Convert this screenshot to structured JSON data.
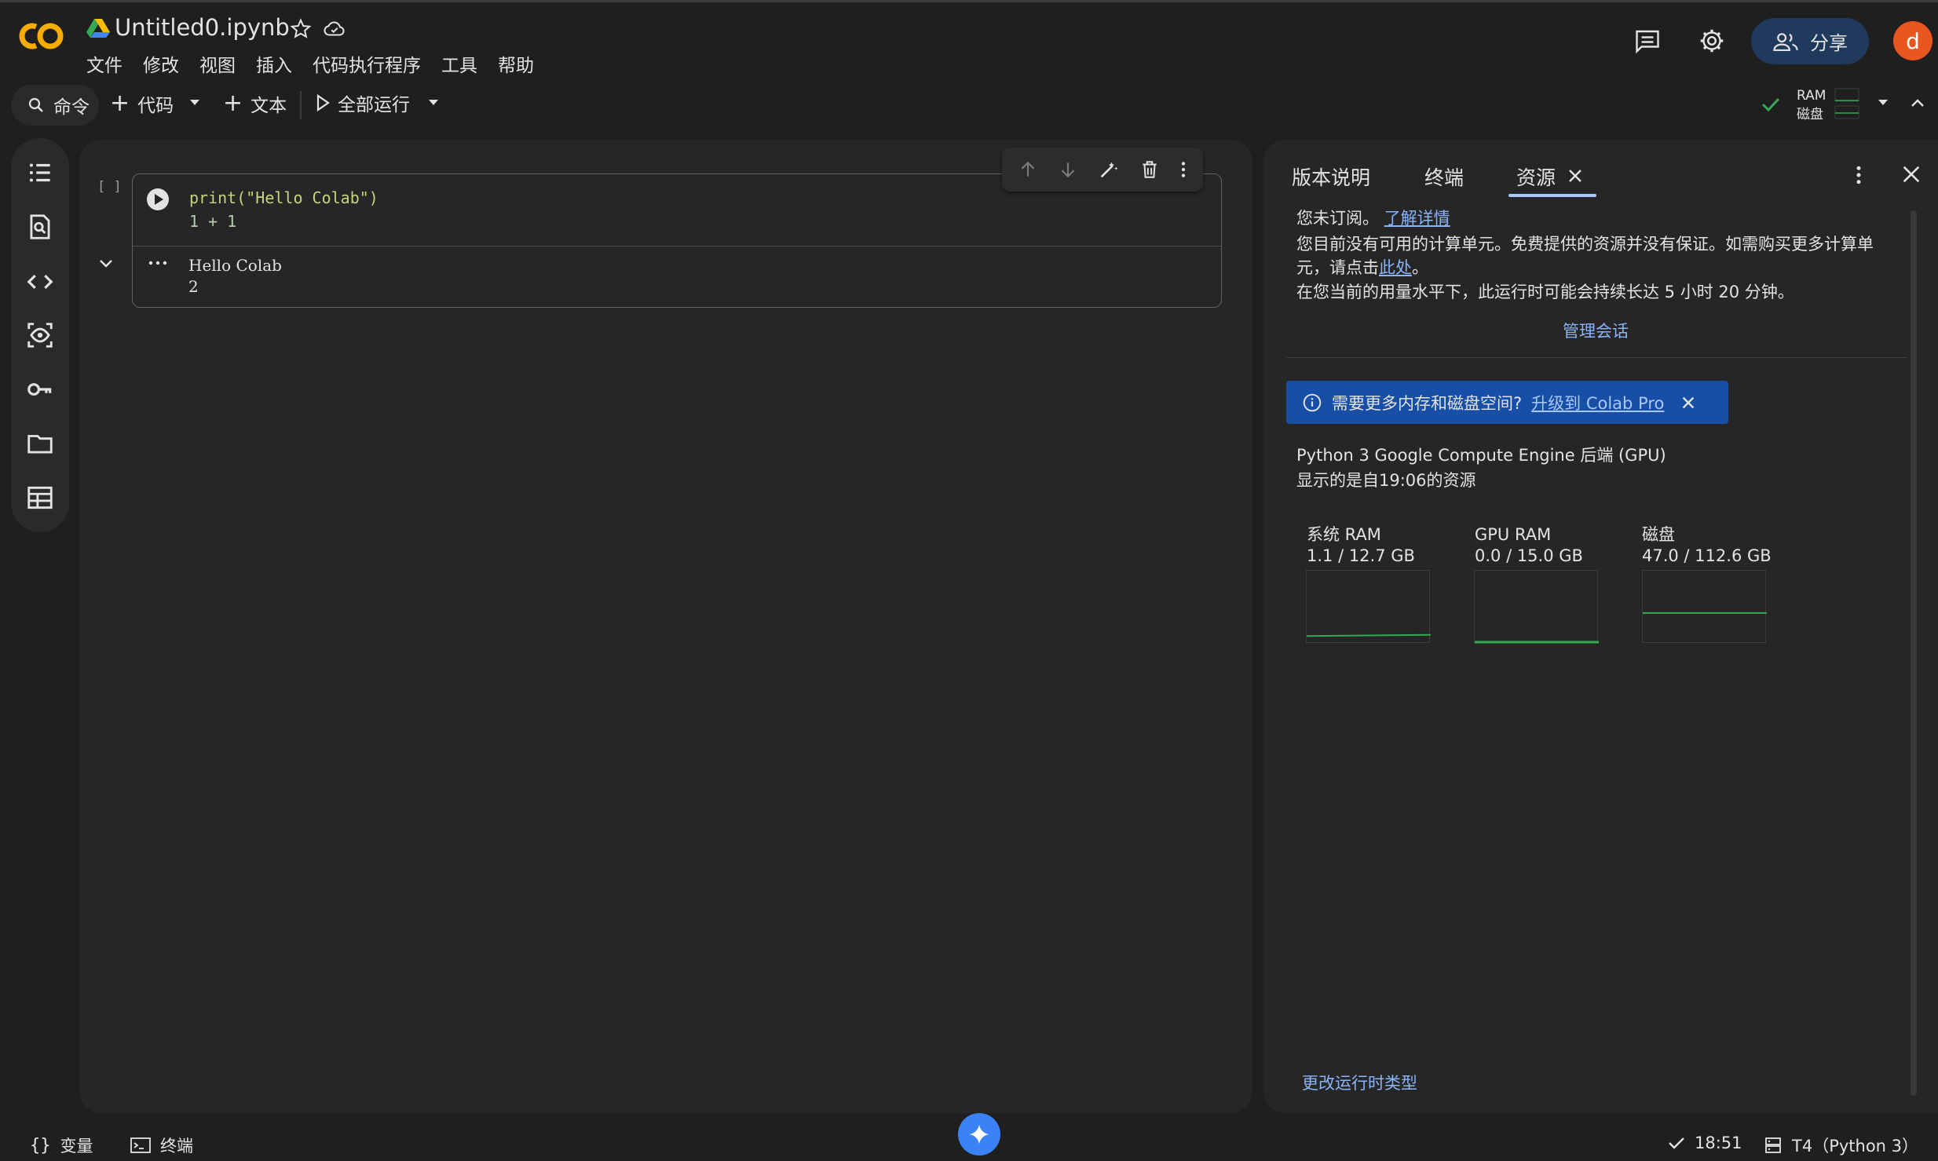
{
  "header": {
    "title": "Untitled0.ipynb",
    "logo_icon": "colab-logo-icon",
    "menu": [
      "文件",
      "修改",
      "视图",
      "插入",
      "代码执行程序",
      "工具",
      "帮助"
    ],
    "share_label": "分享",
    "avatar_letter": "d"
  },
  "toolbar": {
    "command_label": "命令",
    "code_label": "代码",
    "text_label": "文本",
    "run_all_label": "全部运行",
    "ram_label": "RAM",
    "disk_label": "磁盘"
  },
  "cell": {
    "exec_count": "[ ]",
    "code_lines": [
      "print(\"Hello  Colab\")",
      "1  +  1"
    ],
    "output_lines": [
      "Hello Colab",
      "2"
    ]
  },
  "panel": {
    "tabs": [
      "版本说明",
      "终端",
      "资源"
    ],
    "not_subscribed": "您未订阅。",
    "learn_more": "了解详情",
    "no_units_text": "您目前没有可用的计算单元。免费提供的资源并没有保证。如需购买更多计算单元，请点击",
    "here_link": "此处",
    "period": "。",
    "runtime_estimate": "在您当前的用量水平下，此运行时可能会持续长达 5 小时 20 分钟。",
    "manage_sessions": "管理会话",
    "banner_text": "需要更多内存和磁盘空间?",
    "banner_link": "升级到 Colab Pro",
    "backend": "Python 3 Google Compute Engine 后端 (GPU)",
    "shown_since": "显示的是自19:06的资源",
    "resources": [
      {
        "name": "系统 RAM",
        "value": "1.1 / 12.7 GB",
        "fraction": 0.087
      },
      {
        "name": "GPU RAM",
        "value": "0.0 / 15.0 GB",
        "fraction": 0.0
      },
      {
        "name": "磁盘",
        "value": "47.0 / 112.6 GB",
        "fraction": 0.417
      }
    ],
    "change_runtime": "更改运行时类型"
  },
  "status": {
    "variables_label": "变量",
    "terminal_label": "终端",
    "time": "18:51",
    "runtime": "T4（Python 3）"
  },
  "colors": {
    "accent_blue": "#8ab4f8",
    "banner_blue": "#174ea6",
    "share_bg": "#1f3a5c",
    "avatar_bg": "#e8571e",
    "chart_green": "#34a853",
    "check_green": "#34a853"
  }
}
